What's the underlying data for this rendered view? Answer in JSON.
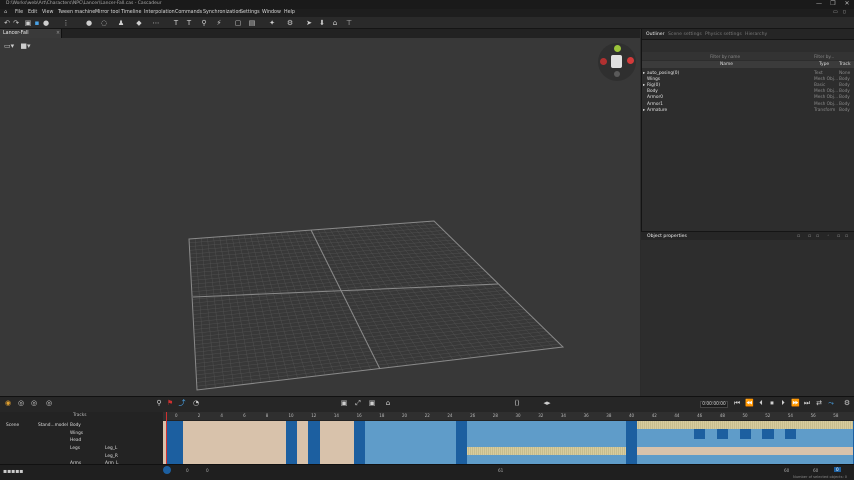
{
  "window": {
    "title": "D:\\Works\\web\\Art\\Characters\\NPC\\Lancer\\Lancer-Fall.cas - Cascadeur",
    "controls": [
      "—",
      "❐",
      "✕"
    ]
  },
  "menu": [
    "File",
    "Edit",
    "View",
    "Tween machine",
    "Mirror tool",
    "Timeline",
    "Interpolation",
    "Commands",
    "Synchronization",
    "Settings",
    "Window",
    "Help"
  ],
  "doc_tab": {
    "label": "Lancer-Fall",
    "close": "×"
  },
  "outliner": {
    "tabs": [
      "Outliner",
      "Scene settings",
      "Physics settings",
      "Hierarchy"
    ],
    "filter_placeholder": "Filter by name",
    "filter_type": "Filter by...",
    "columns": {
      "name": "Name",
      "type": "Type",
      "track": "Track"
    },
    "rows": [
      {
        "name": "auto_posing(0)",
        "type": "Text",
        "track": "None",
        "expand": "▸"
      },
      {
        "name": "Wings",
        "type": "Mesh Obj...",
        "track": "Body",
        "expand": ""
      },
      {
        "name": "Rig(0)",
        "type": "Basic",
        "track": "Body",
        "expand": "▸"
      },
      {
        "name": "Body",
        "type": "Mesh Obj...",
        "track": "Body",
        "expand": ""
      },
      {
        "name": "Armor0",
        "type": "Mesh Obj...",
        "track": "Body",
        "expand": ""
      },
      {
        "name": "Armor1",
        "type": "Mesh Obj...",
        "track": "Body",
        "expand": ""
      },
      {
        "name": "Armature",
        "type": "Transform",
        "track": "Body",
        "expand": "▸"
      }
    ]
  },
  "object_properties": {
    "title": "Object properties"
  },
  "playback": {
    "time": "0:00:00:00"
  },
  "timeline": {
    "tracks_header": "Tracks",
    "scene_label": "Scene",
    "model_label": "Stand...model",
    "tracks": [
      "Body",
      "Wings",
      "Head",
      "Legs",
      "Arms"
    ],
    "subtracks": [
      "Leg_L",
      "Leg_R",
      "Arm_L"
    ],
    "ruler": [
      "0",
      "2",
      "4",
      "6",
      "8",
      "10",
      "12",
      "14",
      "16",
      "18",
      "20",
      "22",
      "24",
      "26",
      "28",
      "30",
      "32",
      "34",
      "36",
      "38",
      "40",
      "42",
      "44",
      "46",
      "48",
      "50",
      "52",
      "54",
      "56",
      "58",
      "60"
    ],
    "frame_current": "0",
    "frame_end": "61",
    "status_fps_a": "60",
    "status_fps_b": "60",
    "status_counter": "0",
    "status_counter_b": "0",
    "status_text": "Number of selected objects: 0"
  },
  "colors": {
    "key_blue": "#1c5fa0",
    "interval_blue": "#5f9cc9",
    "interval_tan": "#d8c2ab",
    "interval_checker": "#cfc59a",
    "accent_red": "#d03030"
  }
}
